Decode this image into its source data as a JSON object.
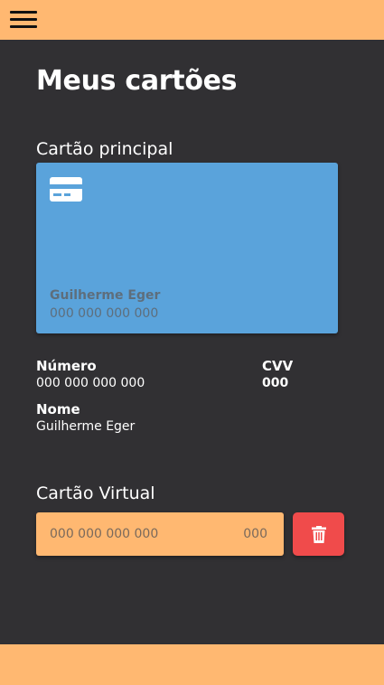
{
  "header": {
    "menu_icon": "hamburger-menu-icon",
    "background": "#FFB871"
  },
  "page": {
    "title": "Meus cartões",
    "background": "#313033"
  },
  "main_card": {
    "section_title": "Cartão principal",
    "icon": "credit-card-icon",
    "holder": "Guilherme Eger",
    "number": "000 000 000 000",
    "color": "#5AA3DB"
  },
  "details": {
    "number_label": "Número",
    "number_value": "000 000 000 000",
    "cvv_label": "CVV",
    "cvv_value": "000",
    "name_label": "Nome",
    "name_value": "Guilherme Eger"
  },
  "virtual_card": {
    "section_title": "Cartão Virtual",
    "number": "000 000 000 000",
    "cvv": "000",
    "color": "#FFB871",
    "delete_icon": "trash-icon",
    "delete_color": "#F04B4B"
  }
}
